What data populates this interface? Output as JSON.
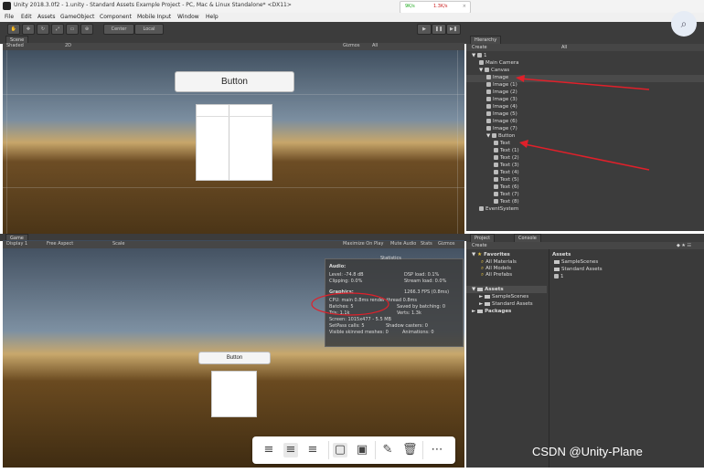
{
  "window": {
    "title": "Unity 2018.3.0f2 - 1.unity - Standard Assets Example Project - PC, Mac & Linux Standalone* <DX11>"
  },
  "net_speed": {
    "down": "9K/s",
    "up": "1.3K/s",
    "close": "×"
  },
  "menu": [
    "File",
    "Edit",
    "Assets",
    "GameObject",
    "Component",
    "Mobile Input",
    "Window",
    "Help"
  ],
  "toolbar": {
    "center": "Center",
    "local": "Local",
    "play": "▶",
    "pause": "❚❚",
    "step": "▶❚"
  },
  "scene": {
    "tab": "Scene",
    "shading": "Shaded",
    "mode_2d": "2D",
    "gizmos": "Gizmos",
    "search": "All",
    "button_label": "Button"
  },
  "game": {
    "tab": "Game",
    "display": "Display 1",
    "aspect": "Free Aspect",
    "scale": "Scale",
    "maximize": "Maximize On Play",
    "mute": "Mute Audio",
    "stats": "Stats",
    "gizmos": "Gizmos",
    "button_label": "Button"
  },
  "statistics": {
    "title": "Statistics",
    "audio_header": "Audio:",
    "level": "Level: -74.8 dB",
    "clipping": "Clipping: 0.0%",
    "dsp_load": "DSP load: 0.1%",
    "stream_load": "Stream load: 0.0%",
    "graphics_header": "Graphics:",
    "fps": "1266.3 FPS (0.8ms)",
    "cpu": "CPU: main 0.8ms render thread 0.8ms",
    "batches": "Batches: 5",
    "saved_batching": "Saved by batching: 0",
    "tris": "Tris: 1.1k",
    "verts": "Verts: 1.3k",
    "screen": "Screen: 1015x477 - 5.5 MB",
    "setpass": "SetPass calls: 5",
    "shadow_casters": "Shadow casters: 0",
    "visible_skinned": "Visible skinned meshes: 0",
    "animations": "Animations: 0"
  },
  "hierarchy": {
    "tab": "Hierarchy",
    "create": "Create",
    "search": "All",
    "scene_name": "1",
    "items": [
      {
        "label": "Main Camera",
        "indent": 1
      },
      {
        "label": "Canvas",
        "indent": 1
      },
      {
        "label": "Image",
        "indent": 2
      },
      {
        "label": "Image (1)",
        "indent": 2
      },
      {
        "label": "Image (2)",
        "indent": 2
      },
      {
        "label": "Image (3)",
        "indent": 2
      },
      {
        "label": "Image (4)",
        "indent": 2
      },
      {
        "label": "Image (5)",
        "indent": 2
      },
      {
        "label": "Image (6)",
        "indent": 2
      },
      {
        "label": "Image (7)",
        "indent": 2
      },
      {
        "label": "Button",
        "indent": 2
      },
      {
        "label": "Text",
        "indent": 3
      },
      {
        "label": "Text (1)",
        "indent": 3
      },
      {
        "label": "Text (2)",
        "indent": 3
      },
      {
        "label": "Text (3)",
        "indent": 3
      },
      {
        "label": "Text (4)",
        "indent": 3
      },
      {
        "label": "Text (5)",
        "indent": 3
      },
      {
        "label": "Text (6)",
        "indent": 3
      },
      {
        "label": "Text (7)",
        "indent": 3
      },
      {
        "label": "Text (8)",
        "indent": 3
      },
      {
        "label": "EventSystem",
        "indent": 1
      }
    ]
  },
  "project": {
    "tab_project": "Project",
    "tab_console": "Console",
    "create": "Create",
    "favorites_header": "Favorites",
    "favorites": [
      "All Materials",
      "All Models",
      "All Prefabs"
    ],
    "assets_header": "Assets",
    "assets_tree": [
      "SampleScenes",
      "Standard Assets"
    ],
    "packages": "Packages",
    "right_header": "Assets",
    "right_items": [
      "SampleScenes",
      "Standard Assets",
      "1"
    ]
  },
  "overlay": {
    "icons": [
      "align-left-icon",
      "align-center-icon",
      "align-right-icon",
      "frame-icon",
      "frame-caption-icon",
      "pen-icon",
      "trash-icon",
      "more-icon"
    ],
    "watermark": "CSDN @Unity-Plane"
  },
  "colors": {
    "accent_red": "#e0202a",
    "bg_dark": "#3c3c3c"
  }
}
